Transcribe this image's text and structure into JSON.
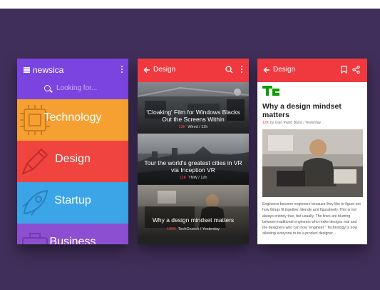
{
  "colors": {
    "background": "#412f5b",
    "purple": "#7b44e0",
    "red": "#f0393f",
    "orange": "#f6a032",
    "blue": "#3ca5e8",
    "violet": "#8d4fd2"
  },
  "screen1": {
    "brand": "newsica",
    "search_placeholder": "Looking for...",
    "categories": [
      {
        "label": "Technology",
        "icon": "chip-icon"
      },
      {
        "label": "Design",
        "icon": "pen-icon"
      },
      {
        "label": "Startup",
        "icon": "rocket-icon"
      },
      {
        "label": "Business",
        "icon": "briefcase-icon"
      }
    ]
  },
  "screen2": {
    "title": "Design",
    "cards": [
      {
        "title": "'Cloaking' Film for Windows Blacks Out the Screens Within",
        "count": "12K",
        "source": "Wired / 12h"
      },
      {
        "title": "Tour the world's greatest cities in VR via Inception VR",
        "count": "12K",
        "source": "TNW / 12h"
      },
      {
        "title": "Why a design mindset matters",
        "count": "100K",
        "source": "TechCrunch / Yesterday"
      }
    ]
  },
  "screen3": {
    "title": "Design",
    "logo": "TC",
    "article_title": "Why a design mindset matters",
    "count": "12K",
    "byline": "by Gian Paolo Bassi / Yesterday",
    "body": "Engineers become engineers because they like to figure out how things fit together, literally and figuratively. This is not always entirely true, but usually. The lines are blurring between traditional engineers who make designs real and the designers who can now \"engineer.\" Technology is now allowing everyone to be a product designer..."
  }
}
